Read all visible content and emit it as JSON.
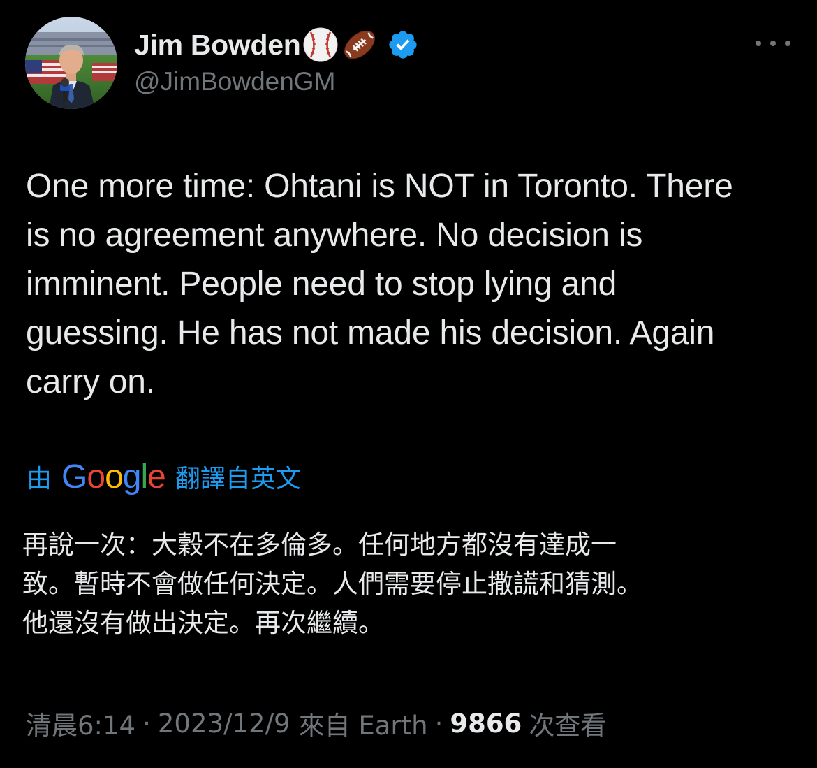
{
  "author": {
    "name": "Jim Bowden",
    "handle": "@JimBowdenGM",
    "emojis": [
      "baseball-emoji",
      "american-football-emoji"
    ],
    "verified": true
  },
  "tweet": {
    "text_lines": [
      "One more time: Ohtani is NOT in Toronto. There",
      "is no agreement anywhere. No decision is",
      "imminent. People need to stop lying and",
      "guessing. He has not made his decision. Again",
      "carry on."
    ]
  },
  "translation": {
    "prefix": "由",
    "provider": "Google",
    "suffix": "翻譯自英文",
    "text_lines": [
      "再說一次：大穀不在多倫多。任何地方都沒有達成一",
      "致。暫時不會做任何決定。人們需要停止撒謊和猜測。",
      "他還沒有做出決定。再次繼續。"
    ]
  },
  "meta": {
    "time": "清晨6:14",
    "date": "2023/12/9",
    "source": "來自 Earth",
    "views_count": "9866",
    "views_label": "次查看",
    "separator": "·"
  },
  "colors": {
    "background": "#000000",
    "primary_text": "#e7e9ea",
    "secondary_text": "#71767b",
    "accent_blue": "#1d9bf0",
    "google_blue": "#4285F4",
    "google_red": "#EA4335",
    "google_yellow": "#FBBC05",
    "google_green": "#34A853"
  }
}
